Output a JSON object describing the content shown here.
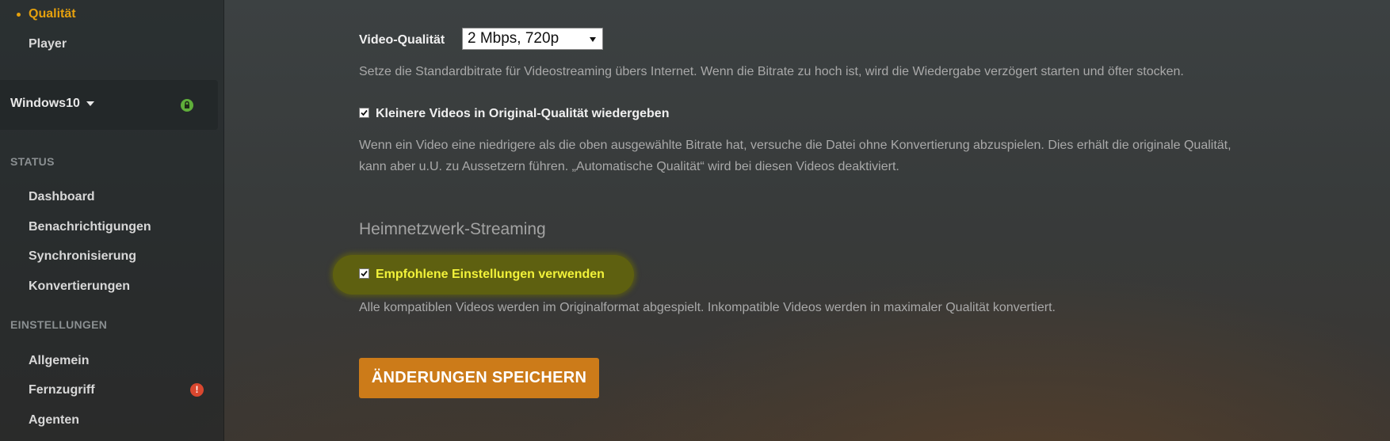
{
  "sidebar": {
    "top_items": [
      {
        "label": "Qualität",
        "active": true
      },
      {
        "label": "Player",
        "active": false
      }
    ],
    "server": {
      "name": "Windows10"
    },
    "status_section": {
      "header": "STATUS",
      "items": [
        "Dashboard",
        "Benachrichtigungen",
        "Synchronisierung",
        "Konvertierungen"
      ]
    },
    "settings_section": {
      "header": "EINSTELLUNGEN",
      "items": [
        "Allgemein",
        "Fernzugriff",
        "Agenten"
      ]
    }
  },
  "main": {
    "video_quality": {
      "label": "Video-Qualität",
      "selected": "2 Mbps, 720p",
      "description": "Setze die Standardbitrate für Videostreaming übers Internet. Wenn die Bitrate zu hoch ist, wird die Wiedergabe verzögert starten und öfter stocken."
    },
    "smaller_videos": {
      "label": "Kleinere Videos in Original-Qualität wiedergeben",
      "checked": true,
      "description_line1": "Wenn ein Video eine niedrigere als die oben ausgewählte Bitrate hat, versuche die Datei ohne Konvertierung abzuspielen. Dies erhält die originale Qualität,",
      "description_line2": "kann aber u.U. zu Aussetzern führen. „Automatische Qualität“ wird bei diesen Videos deaktiviert."
    },
    "home_streaming": {
      "title": "Heimnetzwerk-Streaming",
      "recommended_label": "Empfohlene Einstellungen verwenden",
      "checked": true,
      "description": "Alle kompatiblen Videos werden im Originalformat abgespielt. Inkompatible Videos werden in maximaler Qualität konvertiert."
    },
    "save_button": "ÄNDERUNGEN SPEICHERN"
  },
  "colors": {
    "accent": "#e5a00d",
    "button": "#cc7b19",
    "highlight": "#e8e820",
    "alert": "#d9472f",
    "lock": "#5fae3a"
  }
}
